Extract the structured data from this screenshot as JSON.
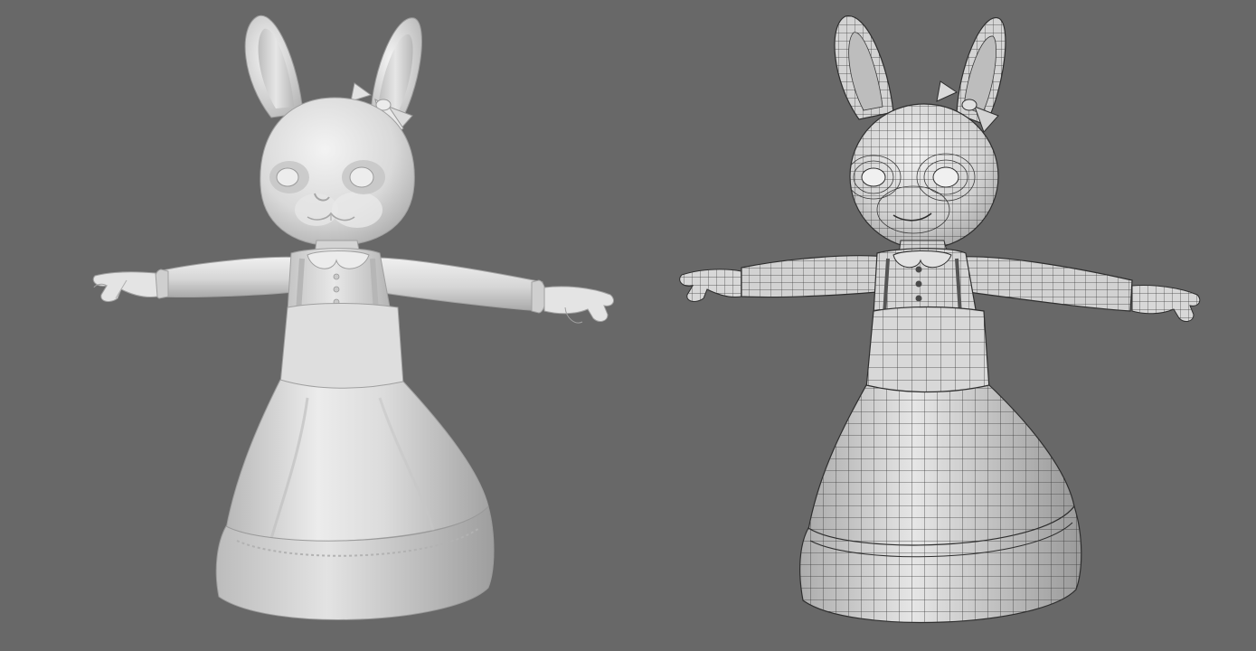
{
  "scene": {
    "background_color": "#686868",
    "render_left": {
      "description_icon": "bunny-clay-render-icon",
      "shading": "smooth",
      "base_color": "#d7d7d7",
      "highlight_color": "#f2f2f2",
      "shadow_color": "#a9a9a9"
    },
    "render_right": {
      "description_icon": "bunny-wireframe-render-icon",
      "shading": "wireframe-on-shaded",
      "base_color": "#d2d2d2",
      "highlight_color": "#ececec",
      "shadow_color": "#9c9c9c",
      "wire_color": "#3a3a3a"
    }
  }
}
